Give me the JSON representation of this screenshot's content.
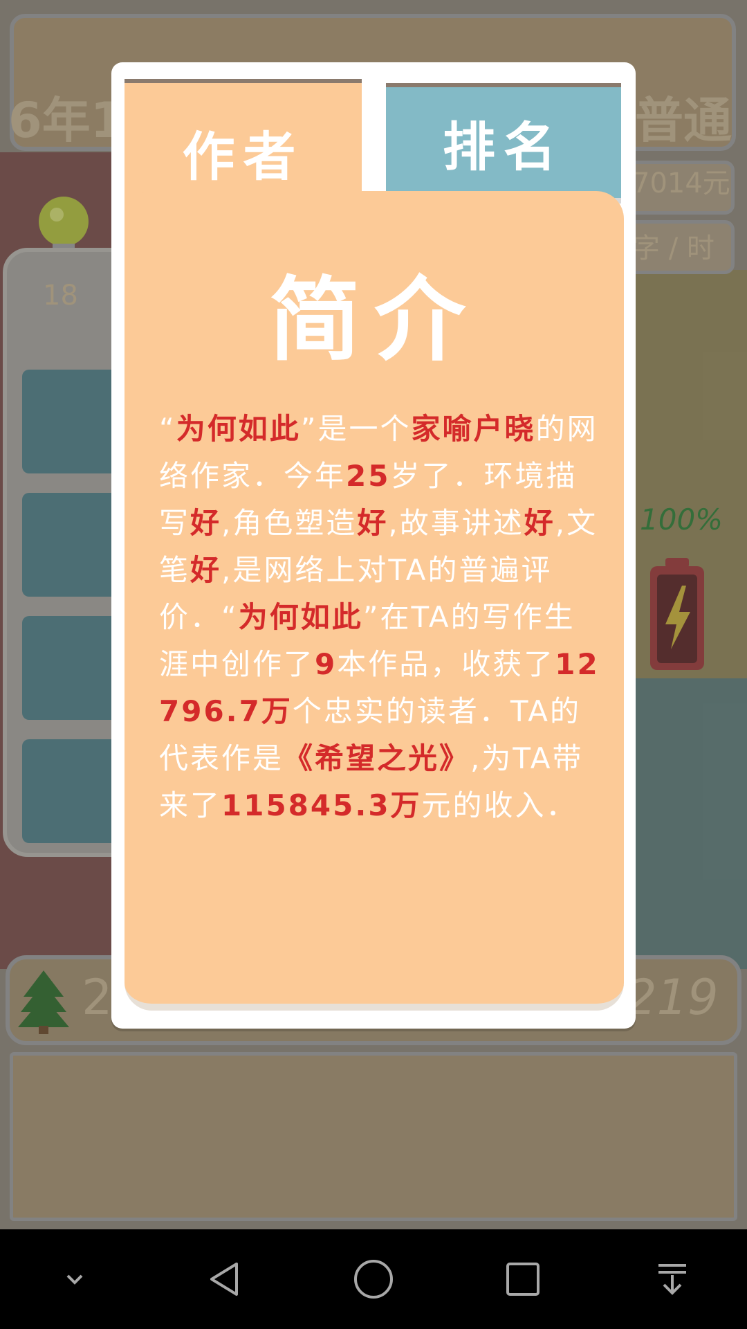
{
  "background": {
    "top_left_text": "6年1",
    "top_right_text": "普通",
    "money_text": "7014元",
    "rate_text": "字 / 时",
    "panel_number": "18",
    "battery_percent_text": "100%",
    "bottom_left_number": "2",
    "bottom_right_number": "219"
  },
  "tabs": {
    "author": "作者",
    "ranking": "排名"
  },
  "card": {
    "title": "简介",
    "bio": [
      {
        "t": "“",
        "hl": false
      },
      {
        "t": "为何如此",
        "hl": true
      },
      {
        "t": "”是一个",
        "hl": false
      },
      {
        "t": "家喻户晓",
        "hl": true
      },
      {
        "t": "的网络作家．今年",
        "hl": false
      },
      {
        "t": "25",
        "hl": true
      },
      {
        "t": "岁了．环境描写",
        "hl": false
      },
      {
        "t": "好",
        "hl": true
      },
      {
        "t": ",角色塑造",
        "hl": false
      },
      {
        "t": "好",
        "hl": true
      },
      {
        "t": ",故事讲述",
        "hl": false
      },
      {
        "t": "好",
        "hl": true
      },
      {
        "t": ",文笔",
        "hl": false
      },
      {
        "t": "好",
        "hl": true
      },
      {
        "t": ",是网络上对TA的普遍评价．“",
        "hl": false
      },
      {
        "t": "为何如此",
        "hl": true
      },
      {
        "t": "”在TA的写作生涯中创作了",
        "hl": false
      },
      {
        "t": "9",
        "hl": true
      },
      {
        "t": "本作品，收获了",
        "hl": false
      },
      {
        "t": "12796.7万",
        "hl": true
      },
      {
        "t": "个忠实的读者．TA的代表作是",
        "hl": false
      },
      {
        "t": "《希望之光》",
        "hl": true
      },
      {
        "t": ",为TA带来了",
        "hl": false
      },
      {
        "t": "115845.3万",
        "hl": true
      },
      {
        "t": "元的收入．",
        "hl": false
      }
    ]
  },
  "nav": {
    "icons": [
      "chevron-down-icon",
      "back-icon",
      "home-icon",
      "recents-icon",
      "download-icon"
    ]
  },
  "colors": {
    "card_bg": "#fcca97",
    "rank_tab_bg": "#83bac6",
    "highlight": "#d42a2a"
  }
}
